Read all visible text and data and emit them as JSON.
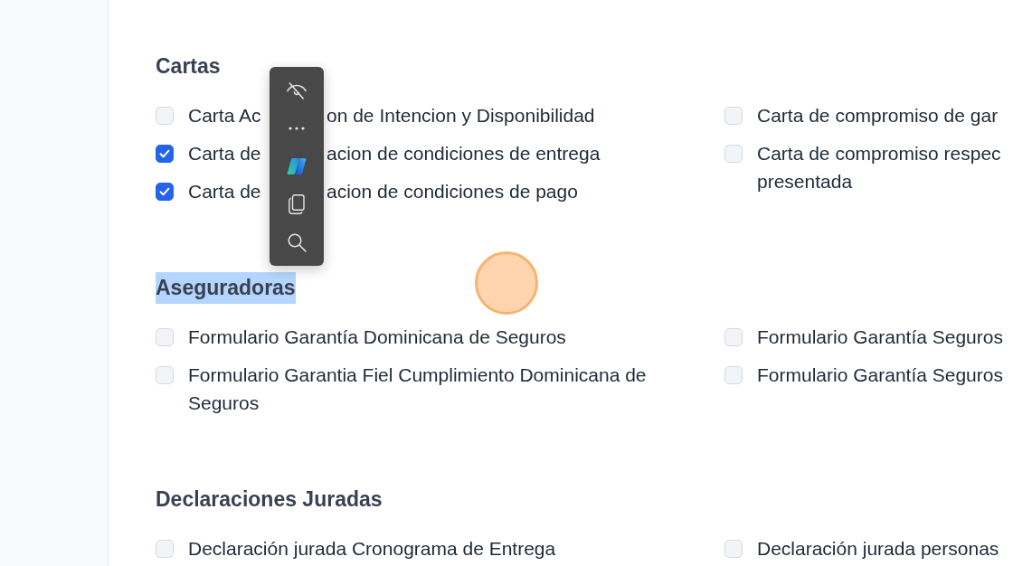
{
  "sections": [
    {
      "title": "Cartas",
      "title_selected": false,
      "columns": [
        {
          "items": [
            {
              "kind": "covered",
              "label_parts": [
                "Carta Ac",
                "on de Intencion y Disponibilidad"
              ],
              "checked": false
            },
            {
              "kind": "covered",
              "label_parts": [
                "Carta de",
                "acion de condiciones de entrega"
              ],
              "checked": true
            },
            {
              "kind": "covered",
              "label_parts": [
                "Carta de",
                "acion de condiciones de pago"
              ],
              "checked": true
            }
          ]
        },
        {
          "items": [
            {
              "kind": "plain",
              "label": "Carta de compromiso de gar",
              "checked": false
            },
            {
              "kind": "lines",
              "label_lines": [
                "Carta de compromiso respec",
                "presentada"
              ],
              "checked": false
            }
          ]
        }
      ]
    },
    {
      "title": "Aseguradoras",
      "title_selected": true,
      "columns": [
        {
          "items": [
            {
              "kind": "plain",
              "label": "Formulario Garantía Dominicana de Seguros",
              "checked": false
            },
            {
              "kind": "plain",
              "label": "Formulario Garantia Fiel Cumplimiento Dominicana de Seguros",
              "checked": false
            }
          ]
        },
        {
          "items": [
            {
              "kind": "plain",
              "label": "Formulario Garantía Seguros",
              "checked": false
            },
            {
              "kind": "plain",
              "label": "Formulario Garantía Seguros",
              "checked": false
            }
          ]
        }
      ]
    },
    {
      "title": "Declaraciones Juradas",
      "title_selected": false,
      "columns": [
        {
          "items": [
            {
              "kind": "plain",
              "label": "Declaración jurada Cronograma de Entrega",
              "checked": false
            }
          ]
        },
        {
          "items": [
            {
              "kind": "plain",
              "label": "Declaración jurada personas",
              "checked": false
            }
          ]
        }
      ]
    }
  ]
}
